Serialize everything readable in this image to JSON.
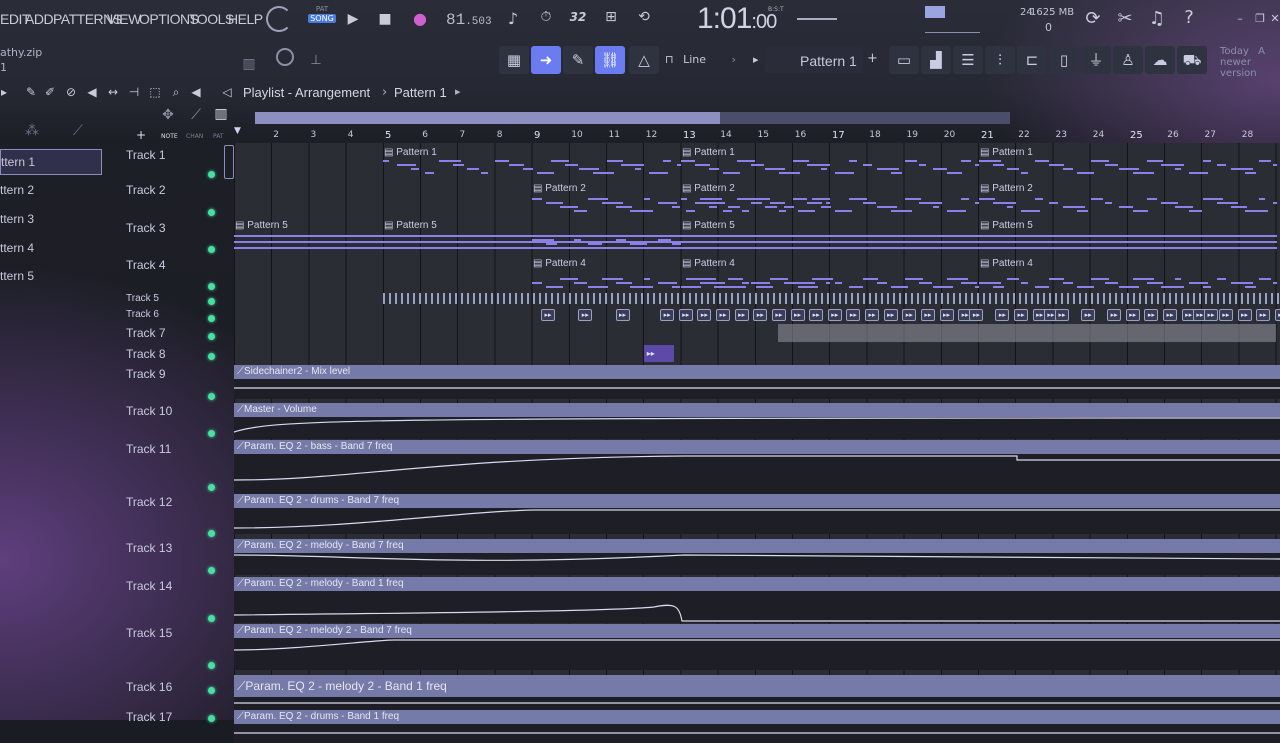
{
  "menu": [
    "EDIT",
    "ADD",
    "PATTERNS",
    "VIEW",
    "OPTIONS",
    "TOOLS",
    "HELP"
  ],
  "project_file": "athy.zip",
  "project_file_sub": "1",
  "transport": {
    "pat_label": "PAT",
    "song_label": "SONG",
    "tempo": "81",
    "tempo_decimal": ".503",
    "time_main": "1:01",
    "time_sub": ":00",
    "time_unit": "B:S:T",
    "cpu": "24",
    "mem": "1625 MB",
    "mem_sub": "0"
  },
  "toolbar2": {
    "snap": "Line",
    "pattern": "Pattern 1"
  },
  "hint": {
    "line1": "Today",
    "line1b": "A",
    "line2": "newer version"
  },
  "playlist_title": "Playlist - Arrangement",
  "playlist_sub": "Pattern 1",
  "patterns": [
    "ttern 1",
    "ttern 2",
    "ttern 3",
    "ttern 4",
    "ttern 5"
  ],
  "col_heads": {
    "note": "NOTE",
    "chan": "CHAN",
    "pat": "PAT"
  },
  "ruler": [
    "2",
    "3",
    "4",
    "5",
    "6",
    "7",
    "8",
    "9",
    "10",
    "11",
    "12",
    "13",
    "14",
    "15",
    "16",
    "17",
    "18",
    "19",
    "20",
    "21",
    "22",
    "23",
    "24",
    "25",
    "26",
    "27",
    "28"
  ],
  "tracks": [
    "Track 1",
    "Track 2",
    "Track 3",
    "Track 4",
    "Track 5",
    "Track 6",
    "Track 7",
    "Track 8",
    "Track 9",
    "Track 10",
    "Track 11",
    "Track 12",
    "Track 13",
    "Track 14",
    "Track 15",
    "Track 16",
    "Track 17"
  ],
  "clips": {
    "p1": "Pattern 1",
    "p2": "Pattern 2",
    "p4": "Pattern 4",
    "p5": "Pattern 5"
  },
  "automation": [
    "Sidechainer2 - Mix level",
    "Master - Volume",
    "Param. EQ 2 - bass - Band 7 freq",
    "Param. EQ 2 - drums - Band 7 freq",
    "Param. EQ 2 - melody - Band 7 freq",
    "Param. EQ 2 - melody - Band 1 freq",
    "Param. EQ 2 - melody 2 - Band 7 freq",
    "Param. EQ 2 - melody 2 - Band 1 freq",
    "Param. EQ 2 - drums - Band 1 freq"
  ],
  "colors": {
    "accent": "#6b7cf0",
    "led": "#48e0a0",
    "note": "#8c80e8",
    "auto": "#767aa8"
  }
}
